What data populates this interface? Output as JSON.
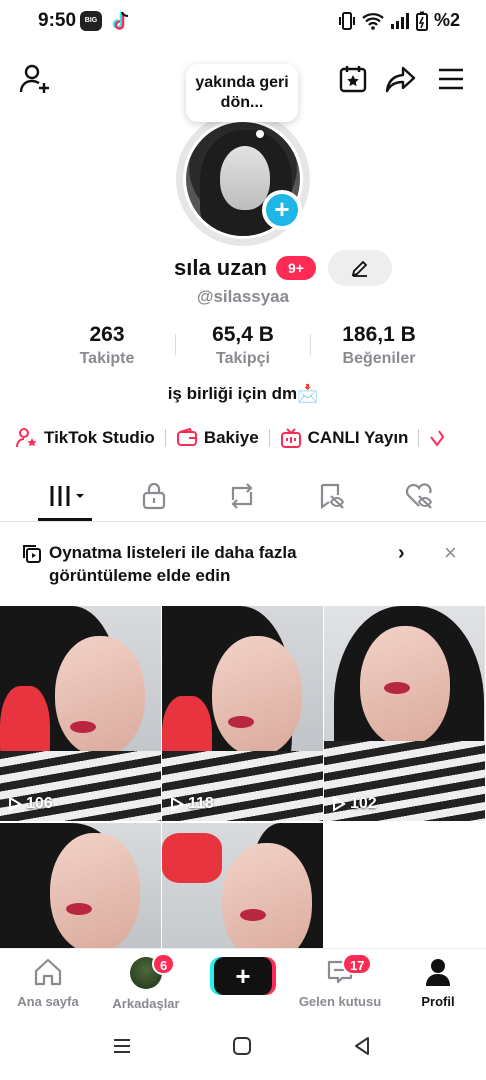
{
  "status_bar": {
    "time": "9:50",
    "app1_label": "BIG",
    "battery_text": "%2"
  },
  "header": {
    "add_friend": "add-person-icon",
    "calendar": "calendar-star-icon",
    "share": "share-icon",
    "menu": "menu-icon"
  },
  "profile": {
    "bubble_text": "yakında geri dön...",
    "name": "sıla uzan",
    "name_badge": "9+",
    "handle": "@silassyaa",
    "bio": "iş birliği için dm📩"
  },
  "stats": [
    {
      "value": "263",
      "label": "Takipte"
    },
    {
      "value": "65,4 B",
      "label": "Takipçi"
    },
    {
      "value": "186,1 B",
      "label": "Beğeniler"
    }
  ],
  "shortcuts": [
    {
      "label": "TikTok Studio",
      "icon": "person-star-icon"
    },
    {
      "label": "Bakiye",
      "icon": "wallet-icon"
    },
    {
      "label": "CANLI Yayın",
      "icon": "live-tv-icon"
    }
  ],
  "tabs": [
    "videos-grid",
    "private-lock",
    "reposts",
    "favorites-eye-off",
    "liked-eye-off"
  ],
  "banner": {
    "text": "Oynatma listeleri ile daha fazla görüntüleme elde edin"
  },
  "videos": [
    {
      "views": "106"
    },
    {
      "views": "118"
    },
    {
      "views": "102"
    },
    {
      "views": ""
    },
    {
      "views": ""
    }
  ],
  "bottom_nav": [
    {
      "label": "Ana sayfa",
      "icon": "home-icon"
    },
    {
      "label": "Arkadaşlar",
      "badge": "6"
    },
    {
      "label": "",
      "icon": "create-icon"
    },
    {
      "label": "Gelen kutusu",
      "badge": "17"
    },
    {
      "label": "Profil",
      "icon": "profile-icon"
    }
  ],
  "colors": {
    "accent": "#fe2c55",
    "cyan": "#25f4ee",
    "plus_blue": "#1fb6e8",
    "muted": "#8a8b91"
  }
}
